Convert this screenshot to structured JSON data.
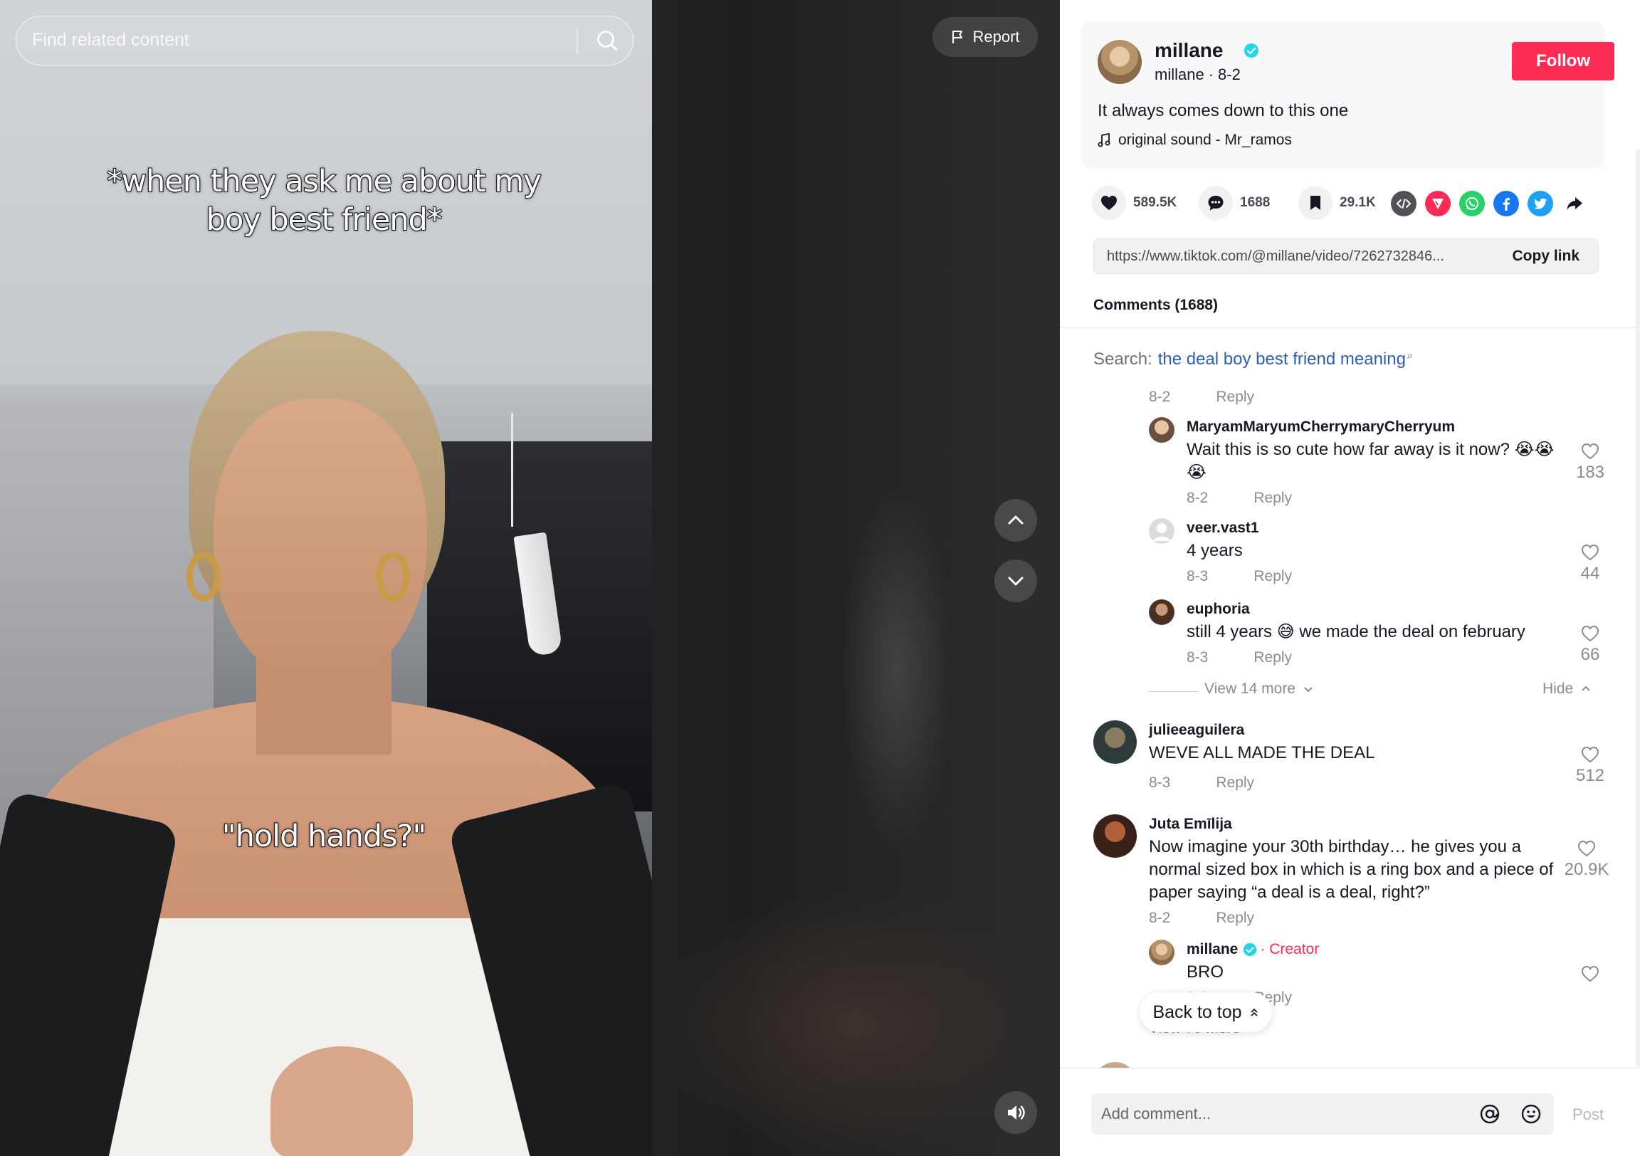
{
  "search": {
    "placeholder": "Find related content"
  },
  "video": {
    "caption_top": "*when they ask me about my boy best friend*",
    "caption_mid": "\"hold hands?\"",
    "report_label": "Report"
  },
  "author": {
    "name": "millane",
    "handle": "millane",
    "date": "8-2",
    "follow_label": "Follow",
    "description": "It always comes down to this one",
    "music": "original sound - Mr_ramos"
  },
  "stats": {
    "likes": "589.5K",
    "comments": "1688",
    "saves": "29.1K"
  },
  "share": {
    "link": "https://www.tiktok.com/@millane/video/7262732846...",
    "copy_label": "Copy link"
  },
  "comments_header": "Comments (1688)",
  "search_suggestion": {
    "prefix": "Search:",
    "term": "the deal boy best friend meaning"
  },
  "comments": {
    "partial_meta": {
      "date": "8-2",
      "reply": "Reply"
    },
    "c1": {
      "user": "MaryamMaryumCherrymaryCherryum",
      "text": "Wait this is so cute how far away is it now? 😭😭😭",
      "date": "8-2",
      "reply": "Reply",
      "likes": "183"
    },
    "c2": {
      "user": "veer.vast1",
      "text": "4 years",
      "date": "8-3",
      "reply": "Reply",
      "likes": "44"
    },
    "c3": {
      "user": "euphoria",
      "text": "still 4 years 😅 we made the deal on february",
      "date": "8-3",
      "reply": "Reply",
      "likes": "66"
    },
    "view_more_1": "View 14 more",
    "hide": "Hide",
    "c4": {
      "user": "julieeaguilera",
      "text": "WEVE ALL MADE THE DEAL",
      "date": "8-3",
      "reply": "Reply",
      "likes": "512"
    },
    "c5": {
      "user": "Juta Emīlija",
      "text": "Now imagine your 30th birthday… he gives you a normal sized box in which is a ring box and a piece of paper saying “a deal is a deal, right?”",
      "date": "8-2",
      "reply": "Reply",
      "likes": "20.9K"
    },
    "c6": {
      "user": "millane",
      "creator_tag": "· Creator",
      "text": "BRO",
      "date": "8-2",
      "reply": "Reply"
    },
    "view_more_2": "View 79 more"
  },
  "back_to_top": "Back to top",
  "comment_box": {
    "placeholder": "Add comment...",
    "post_label": "Post"
  },
  "colors": {
    "accent": "#fe2c55",
    "link_blue": "#2b5db9",
    "verified": "#20d5ec"
  }
}
